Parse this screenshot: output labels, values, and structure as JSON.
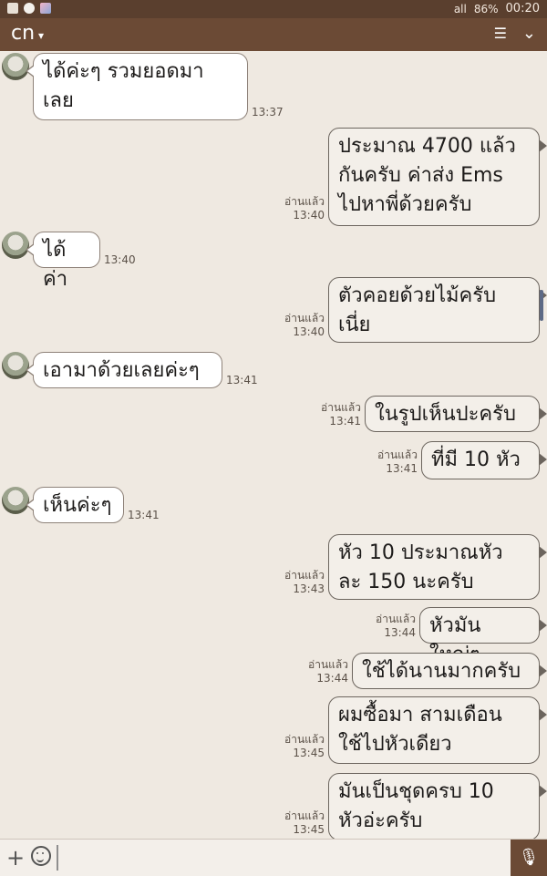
{
  "status": {
    "time": "00:20",
    "battery": "86%",
    "signal": "all",
    "icons": [
      "gallery-icon",
      "line-icon",
      "photo-icon"
    ]
  },
  "header": {
    "title": "cn",
    "dropdown_icon": "chevron-down-icon",
    "menu_icon": "list-icon",
    "collapse_icon": "chevron-down-icon"
  },
  "messages": [
    {
      "side": "in",
      "text": "ได้ค่ะๆ รวมยอดมา\nเลย",
      "time": "13:37"
    },
    {
      "side": "out",
      "text": "ประมาณ 4700 แล้ว\nกันครับ ค่าส่ง Ems\nไปหาพี่ด้วยครับ",
      "read": "อ่านแล้ว",
      "time": "13:40"
    },
    {
      "side": "in",
      "text": "ได้ค่า",
      "time": "13:40"
    },
    {
      "side": "out",
      "text": "ตัวคอยด้วยไม้ครับ\nเนี่ย",
      "read": "อ่านแล้ว",
      "time": "13:40"
    },
    {
      "side": "in",
      "text": "เอามาด้วยเลยค่ะๆ",
      "time": "13:41"
    },
    {
      "side": "out",
      "text": "ในรูปเห็นปะครับ",
      "read": "อ่านแล้ว",
      "time": "13:41"
    },
    {
      "side": "out",
      "text": "ที่มี 10  หัว",
      "read": "อ่านแล้ว",
      "time": "13:41"
    },
    {
      "side": "in",
      "text": "เห็นค่ะๆ",
      "time": "13:41"
    },
    {
      "side": "out",
      "text": "หัว 10 ประมาณหัว\nละ 150 นะครับ",
      "read": "อ่านแล้ว",
      "time": "13:43"
    },
    {
      "side": "out",
      "text": "หัวมันใหญ่ๆ",
      "read": "อ่านแล้ว",
      "time": "13:44"
    },
    {
      "side": "out",
      "text": "ใช้ได้นานมากครับ",
      "read": "อ่านแล้ว",
      "time": "13:44"
    },
    {
      "side": "out",
      "text": "ผมซื้อมา สามเดือน\nใช้ไปหัวเดียว",
      "read": "อ่านแล้ว",
      "time": "13:45"
    },
    {
      "side": "out",
      "text": "มันเป็นชุดครบ 10\nหัวอ่ะครับ",
      "read": "อ่านแล้ว",
      "time": "13:45"
    }
  ],
  "input": {
    "plus_icon": "plus-icon",
    "emoji_icon": "emoji-icon",
    "mic_icon": "microphone-icon"
  }
}
